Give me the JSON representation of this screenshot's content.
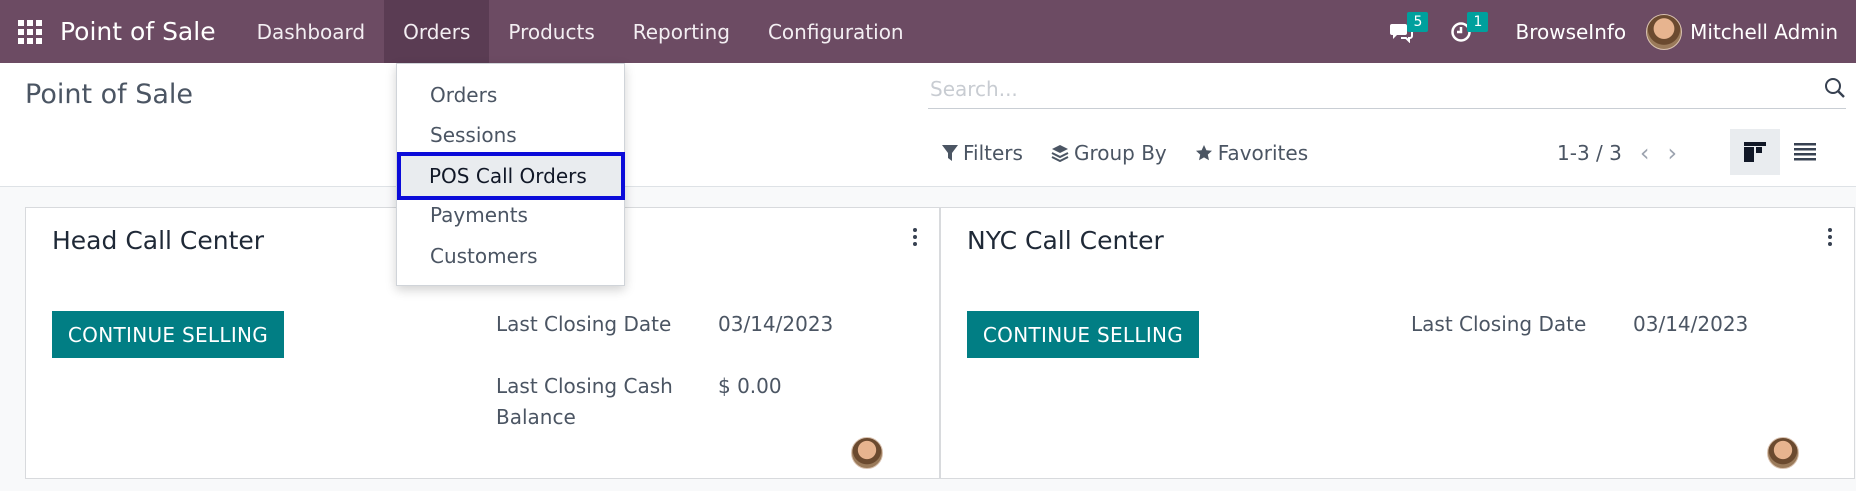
{
  "navbar": {
    "app_name": "Point of Sale",
    "menu": [
      "Dashboard",
      "Orders",
      "Products",
      "Reporting",
      "Configuration"
    ],
    "active_menu": "Orders",
    "messages_count": "5",
    "activities_count": "1",
    "company": "BrowseInfo",
    "user": "Mitchell Admin",
    "accent_color": "#6c4b63"
  },
  "control_panel": {
    "title": "Point of Sale",
    "search_placeholder": "Search...",
    "filters_label": "Filters",
    "group_by_label": "Group By",
    "favorites_label": "Favorites",
    "pager": "1-3 / 3"
  },
  "orders_dropdown": {
    "items": [
      "Orders",
      "Sessions",
      "POS Call Orders",
      "Payments",
      "Customers"
    ],
    "highlighted": "POS Call Orders"
  },
  "cards": [
    {
      "title": "Head Call Center",
      "button": "CONTINUE SELLING",
      "last_closing_date_label": "Last Closing Date",
      "last_closing_date": "03/14/2023",
      "last_cash_balance_label": "Last Closing Cash Balance",
      "last_cash_balance": "$ 0.00"
    },
    {
      "title": "NYC Call Center",
      "button": "CONTINUE SELLING",
      "last_closing_date_label": "Last Closing Date",
      "last_closing_date": "03/14/2023"
    }
  ]
}
